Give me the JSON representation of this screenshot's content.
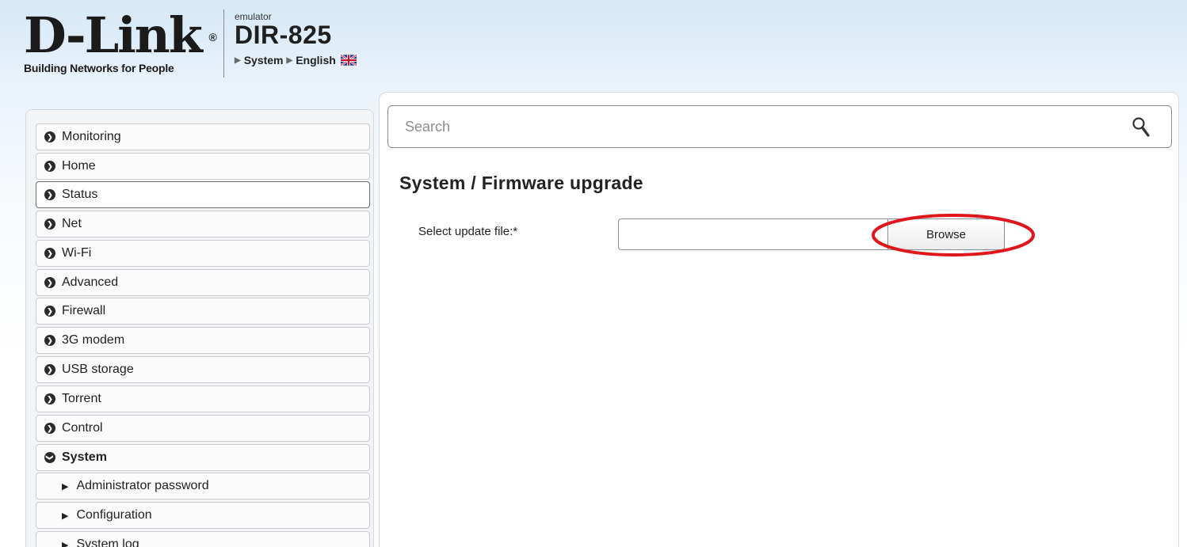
{
  "header": {
    "logo_word": "D-Link",
    "logo_reg": "®",
    "logo_tagline": "Building Networks for People",
    "emulator_label": "emulator",
    "model": "DIR-825",
    "breadcrumb": [
      "System",
      "English"
    ]
  },
  "search": {
    "placeholder": "Search"
  },
  "sidebar": {
    "items": [
      {
        "label": "Monitoring"
      },
      {
        "label": "Home"
      },
      {
        "label": "Status"
      },
      {
        "label": "Net"
      },
      {
        "label": "Wi-Fi"
      },
      {
        "label": "Advanced"
      },
      {
        "label": "Firewall"
      },
      {
        "label": "3G modem"
      },
      {
        "label": "USB storage"
      },
      {
        "label": "Torrent"
      },
      {
        "label": "Control"
      },
      {
        "label": "System"
      }
    ],
    "subitems": [
      {
        "label": "Administrator password"
      },
      {
        "label": "Configuration"
      },
      {
        "label": "System log"
      }
    ]
  },
  "main": {
    "title": "System /  Firmware upgrade",
    "field_label": "Select update file:*",
    "file_value": "",
    "browse_label": "Browse"
  },
  "colors": {
    "highlight": "#e0161d",
    "menu_border": "#c9cdd2"
  }
}
